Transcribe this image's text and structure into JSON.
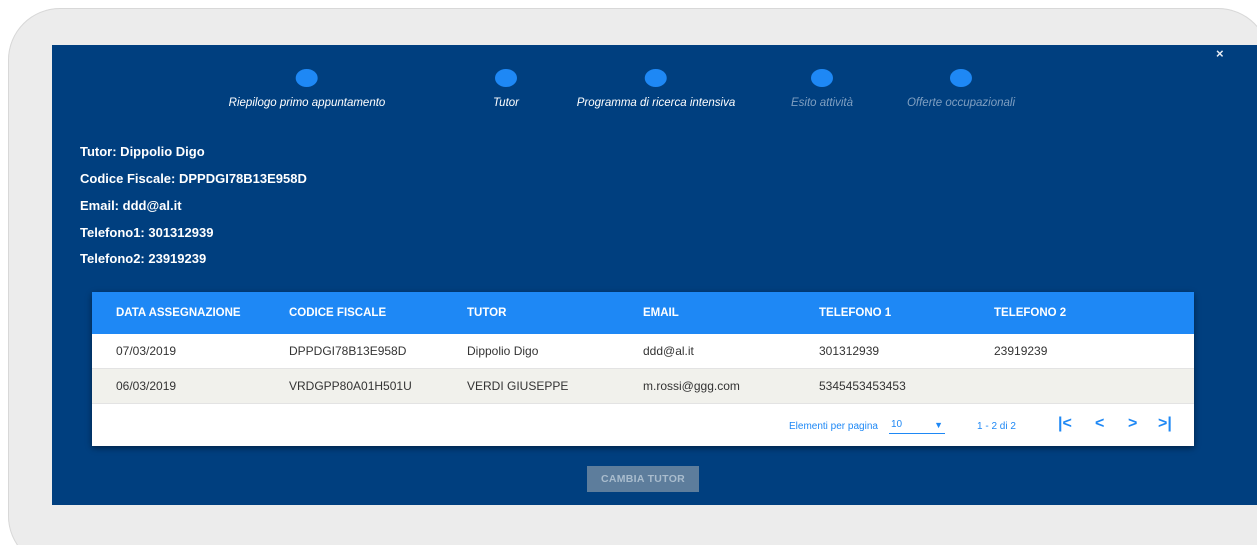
{
  "stepper": {
    "steps": [
      {
        "label": "Riepilogo primo appuntamento",
        "color": "#1e88f5",
        "active": true
      },
      {
        "label": "Tutor",
        "color": "#1e88f5",
        "active": true
      },
      {
        "label": "Programma di ricerca intensiva",
        "color": "#1e88f5",
        "active": true
      },
      {
        "label": "Esito attività",
        "color": "#1e88f5",
        "active": false
      },
      {
        "label": "Offerte occupazionali",
        "color": "#1e88f5",
        "active": false
      }
    ]
  },
  "close_label": "×",
  "tutor_info": {
    "name": "Tutor: Dippolio Digo",
    "codice_fiscale": "Codice Fiscale: DPPDGI78B13E958D",
    "email": "Email: ddd@al.it",
    "telefono1": "Telefono1: 301312939",
    "telefono2": "Telefono2: 23919239"
  },
  "table": {
    "headers": [
      "DATA ASSEGNAZIONE",
      "CODICE FISCALE",
      "TUTOR",
      "EMAIL",
      "TELEFONO 1",
      "TELEFONO 2"
    ],
    "rows": [
      [
        "07/03/2019",
        "DPPDGI78B13E958D",
        "Dippolio Digo",
        "ddd@al.it",
        "301312939",
        "23919239"
      ],
      [
        "06/03/2019",
        "VRDGPP80A01H501U",
        "VERDI GIUSEPPE",
        "m.rossi@ggg.com",
        "5345453453453",
        ""
      ]
    ],
    "header_color": "#1e88f5"
  },
  "pagination": {
    "items_per_page_label": "Elementi per pagina",
    "items_per_page_value": "10",
    "range_label": "1 - 2 di 2",
    "first_icon": "first-page-icon",
    "prev_icon": "chevron-left-icon",
    "next_icon": "chevron-right-icon",
    "last_icon": "last-page-icon"
  },
  "actions": {
    "change_tutor_label": "CAMBIA TUTOR"
  },
  "colors": {
    "modal_bg": "#003f7f",
    "accent": "#1e88f5",
    "disabled_button": "#5d7d9c"
  }
}
